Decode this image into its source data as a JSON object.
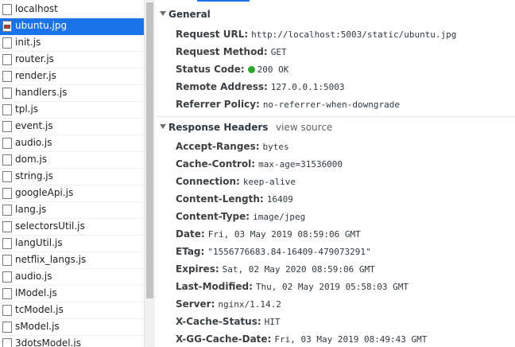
{
  "files": [
    {
      "name": "localhost",
      "icon": "file-icon"
    },
    {
      "name": "ubuntu.jpg",
      "icon": "image-file-icon",
      "selected": true
    },
    {
      "name": "init.js",
      "icon": "file-icon"
    },
    {
      "name": "router.js",
      "icon": "file-icon"
    },
    {
      "name": "render.js",
      "icon": "file-icon"
    },
    {
      "name": "handlers.js",
      "icon": "file-icon"
    },
    {
      "name": "tpl.js",
      "icon": "file-icon"
    },
    {
      "name": "event.js",
      "icon": "file-icon"
    },
    {
      "name": "audio.js",
      "icon": "file-icon"
    },
    {
      "name": "dom.js",
      "icon": "file-icon"
    },
    {
      "name": "string.js",
      "icon": "file-icon"
    },
    {
      "name": "googleApi.js",
      "icon": "file-icon"
    },
    {
      "name": "lang.js",
      "icon": "file-icon"
    },
    {
      "name": "selectorsUtil.js",
      "icon": "file-icon"
    },
    {
      "name": "langUtil.js",
      "icon": "file-icon"
    },
    {
      "name": "netflix_langs.js",
      "icon": "file-icon"
    },
    {
      "name": "audio.js",
      "icon": "file-icon"
    },
    {
      "name": "lModel.js",
      "icon": "file-icon"
    },
    {
      "name": "tcModel.js",
      "icon": "file-icon"
    },
    {
      "name": "sModel.js",
      "icon": "file-icon"
    },
    {
      "name": "3dotsModel.js",
      "icon": "file-icon"
    }
  ],
  "general": {
    "title": "General",
    "rows": [
      {
        "key": "Request URL:",
        "value": "http://localhost:5003/static/ubuntu.jpg"
      },
      {
        "key": "Request Method:",
        "value": "GET"
      },
      {
        "key": "Status Code:",
        "value": "200 OK",
        "status_color": "#2ea52e"
      },
      {
        "key": "Remote Address:",
        "value": "127.0.0.1:5003"
      },
      {
        "key": "Referrer Policy:",
        "value": "no-referrer-when-downgrade"
      }
    ]
  },
  "response_headers": {
    "title": "Response Headers",
    "view_source": "view source",
    "rows": [
      {
        "key": "Accept-Ranges:",
        "value": "bytes"
      },
      {
        "key": "Cache-Control:",
        "value": "max-age=31536000"
      },
      {
        "key": "Connection:",
        "value": "keep-alive"
      },
      {
        "key": "Content-Length:",
        "value": "16409"
      },
      {
        "key": "Content-Type:",
        "value": "image/jpeg"
      },
      {
        "key": "Date:",
        "value": "Fri, 03 May 2019 08:59:06 GMT"
      },
      {
        "key": "ETag:",
        "value": "\"1556776683.84-16409-479073291\""
      },
      {
        "key": "Expires:",
        "value": "Sat, 02 May 2020 08:59:06 GMT"
      },
      {
        "key": "Last-Modified:",
        "value": "Thu, 02 May 2019 05:58:03 GMT"
      },
      {
        "key": "Server:",
        "value": "nginx/1.14.2"
      },
      {
        "key": "X-Cache-Status:",
        "value": "HIT"
      },
      {
        "key": "X-GG-Cache-Date:",
        "value": "Fri, 03 May 2019 08:49:43 GMT"
      }
    ]
  },
  "colors": {
    "selection": "#1a73e8",
    "status_ok": "#2ea52e"
  }
}
